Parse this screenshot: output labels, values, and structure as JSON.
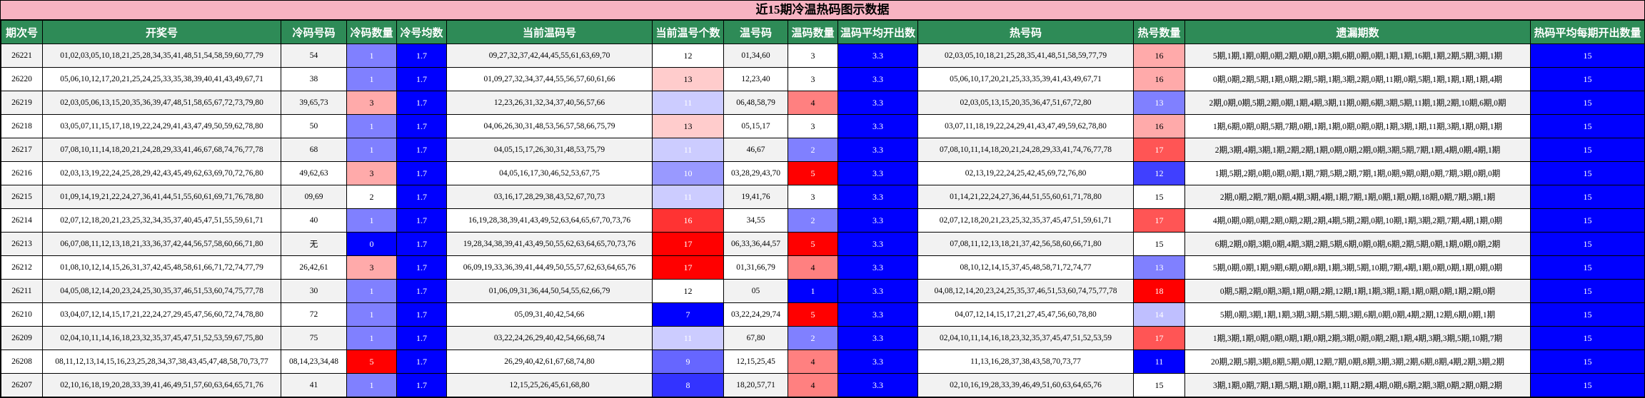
{
  "title": "近15期冷温热码图示数据",
  "headers": [
    "期次号",
    "开奖号",
    "冷码号码",
    "冷码数量",
    "冷号均数",
    "当前温码号",
    "当前温号个数",
    "温号码",
    "温码数量",
    "温码平均开出数",
    "热号码",
    "热号数量",
    "遗漏期数",
    "热码平均每期开出数量"
  ],
  "colors": {
    "header_bg": "#2e8b57",
    "title_bg": "#f7b3c2",
    "blue": "#0000ff",
    "red": "#ff0000",
    "row_alt": "#f2f2f2"
  },
  "rows": [
    {
      "period": "26221",
      "draw": "01,02,03,05,10,18,21,25,28,34,35,41,48,51,54,58,59,60,77,79",
      "cold": "54",
      "cold_cnt": "1",
      "cold_avg": "1.7",
      "warm": "09,27,32,37,42,44,45,55,61,63,69,70",
      "warm_cnt": "12",
      "warm_hit": "01,34,60",
      "warm_hit_cnt": "3",
      "warm_avg": "3.3",
      "hot": "02,03,05,10,18,21,25,28,35,41,48,51,58,59,77,79",
      "hot_cnt": "16",
      "miss": "5期,1期,1期,0期,0期,2期,0期,0期,3期,6期,0期,0期,1期,1期,16期,1期,2期,5期,3期,1期",
      "hot_avg": "15"
    },
    {
      "period": "26220",
      "draw": "05,06,10,12,17,20,21,25,24,25,33,35,38,39,40,41,43,49,67,71",
      "cold": "38",
      "cold_cnt": "1",
      "cold_avg": "1.7",
      "warm": "01,09,27,32,34,37,44,55,56,57,60,61,66",
      "warm_cnt": "13",
      "warm_hit": "12,23,40",
      "warm_hit_cnt": "3",
      "warm_avg": "3.3",
      "hot": "05,06,10,17,20,21,25,33,35,39,41,43,49,67,71",
      "hot_cnt": "16",
      "miss": "0期,0期,2期,5期,1期,0期,2期,5期,1期,3期,2期,0期,11期,0期,5期,1期,1期,1期,1期,4期",
      "hot_avg": "15"
    },
    {
      "period": "26219",
      "draw": "02,03,05,06,13,15,20,35,36,39,47,48,51,58,65,67,72,73,79,80",
      "cold": "39,65,73",
      "cold_cnt": "3",
      "cold_avg": "1.7",
      "warm": "12,23,26,31,32,34,37,40,56,57,66",
      "warm_cnt": "11",
      "warm_hit": "06,48,58,79",
      "warm_hit_cnt": "4",
      "warm_avg": "3.3",
      "hot": "02,03,05,13,15,20,35,36,47,51,67,72,80",
      "hot_cnt": "13",
      "miss": "2期,0期,0期,5期,2期,0期,1期,4期,3期,11期,0期,6期,3期,5期,11期,1期,2期,10期,6期,0期",
      "hot_avg": "15"
    },
    {
      "period": "26218",
      "draw": "03,05,07,11,15,17,18,19,22,24,29,41,43,47,49,50,59,62,78,80",
      "cold": "50",
      "cold_cnt": "1",
      "cold_avg": "1.7",
      "warm": "04,06,26,30,31,48,53,56,57,58,66,75,79",
      "warm_cnt": "13",
      "warm_hit": "05,15,17",
      "warm_hit_cnt": "3",
      "warm_avg": "3.3",
      "hot": "03,07,11,18,19,22,24,29,41,43,47,49,59,62,78,80",
      "hot_cnt": "16",
      "miss": "1期,6期,0期,0期,5期,7期,0期,1期,1期,0期,0期,0期,1期,3期,1期,11期,3期,1期,0期,1期",
      "hot_avg": "15"
    },
    {
      "period": "26217",
      "draw": "07,08,10,11,14,18,20,21,24,28,29,33,41,46,67,68,74,76,77,78",
      "cold": "68",
      "cold_cnt": "1",
      "cold_avg": "1.7",
      "warm": "04,05,15,17,26,30,31,48,53,75,79",
      "warm_cnt": "11",
      "warm_hit": "46,67",
      "warm_hit_cnt": "2",
      "warm_avg": "3.3",
      "hot": "07,08,10,11,14,18,20,21,24,28,29,33,41,74,76,77,78",
      "hot_cnt": "17",
      "miss": "2期,3期,4期,3期,1期,2期,2期,1期,0期,0期,2期,0期,3期,5期,7期,1期,4期,0期,4期,1期",
      "hot_avg": "15"
    },
    {
      "period": "26216",
      "draw": "02,03,13,19,22,24,25,28,29,42,43,45,49,62,63,69,70,72,76,80",
      "cold": "49,62,63",
      "cold_cnt": "3",
      "cold_avg": "1.7",
      "warm": "04,05,16,17,30,46,52,53,67,75",
      "warm_cnt": "10",
      "warm_hit": "03,28,29,43,70",
      "warm_hit_cnt": "5",
      "warm_avg": "3.3",
      "hot": "02,13,19,22,24,25,42,45,69,72,76,80",
      "hot_cnt": "12",
      "miss": "1期,5期,2期,0期,0期,0期,1期,7期,5期,2期,7期,1期,0期,9期,0期,0期,7期,3期,0期,0期",
      "hot_avg": "15"
    },
    {
      "period": "26215",
      "draw": "01,09,14,19,21,22,24,27,36,41,44,51,55,60,61,69,71,76,78,80",
      "cold": "09,69",
      "cold_cnt": "2",
      "cold_avg": "1.7",
      "warm": "03,16,17,28,29,38,43,52,67,70,73",
      "warm_cnt": "11",
      "warm_hit": "19,41,76",
      "warm_hit_cnt": "3",
      "warm_avg": "3.3",
      "hot": "01,14,21,22,24,27,36,44,51,55,60,61,71,78,80",
      "hot_cnt": "15",
      "miss": "2期,0期,2期,7期,0期,4期,3期,4期,1期,7期,1期,0期,1期,0期,18期,0期,7期,3期,1期",
      "hot_avg": "15"
    },
    {
      "period": "26214",
      "draw": "02,07,12,18,20,21,23,25,32,34,35,37,40,45,47,51,55,59,61,71",
      "cold": "40",
      "cold_cnt": "1",
      "cold_avg": "1.7",
      "warm": "16,19,28,38,39,41,43,49,52,63,64,65,67,70,73,76",
      "warm_cnt": "16",
      "warm_hit": "34,55",
      "warm_hit_cnt": "2",
      "warm_avg": "3.3",
      "hot": "02,07,12,18,20,21,23,25,32,35,37,45,47,51,59,61,71",
      "hot_cnt": "17",
      "miss": "4期,0期,0期,0期,2期,0期,2期,2期,4期,5期,2期,0期,10期,1期,3期,2期,7期,4期,1期,0期",
      "hot_avg": "15"
    },
    {
      "period": "26213",
      "draw": "06,07,08,11,12,13,18,21,33,36,37,42,44,56,57,58,60,66,71,80",
      "cold": "无",
      "cold_cnt": "0",
      "cold_avg": "1.7",
      "warm": "19,28,34,38,39,41,43,49,50,55,62,63,64,65,70,73,76",
      "warm_cnt": "17",
      "warm_hit": "06,33,36,44,57",
      "warm_hit_cnt": "5",
      "warm_avg": "3.3",
      "hot": "07,08,11,12,13,18,21,37,42,56,58,60,66,71,80",
      "hot_cnt": "15",
      "miss": "6期,2期,0期,3期,0期,4期,3期,2期,5期,6期,0期,0期,6期,2期,5期,0期,1期,0期,0期,2期",
      "hot_avg": "15"
    },
    {
      "period": "26212",
      "draw": "01,08,10,12,14,15,26,31,37,42,45,48,58,61,66,71,72,74,77,79",
      "cold": "26,42,61",
      "cold_cnt": "3",
      "cold_avg": "1.7",
      "warm": "06,09,19,33,36,39,41,44,49,50,55,57,62,63,64,65,76",
      "warm_cnt": "17",
      "warm_hit": "01,31,66,79",
      "warm_hit_cnt": "4",
      "warm_avg": "3.3",
      "hot": "08,10,12,14,15,37,45,48,58,71,72,74,77",
      "hot_cnt": "13",
      "miss": "5期,0期,0期,1期,9期,6期,0期,8期,1期,3期,5期,10期,7期,4期,1期,0期,0期,1期,0期,0期",
      "hot_avg": "15"
    },
    {
      "period": "26211",
      "draw": "04,05,08,12,14,20,23,24,25,30,35,37,46,51,53,60,74,75,77,78",
      "cold": "30",
      "cold_cnt": "1",
      "cold_avg": "1.7",
      "warm": "01,06,09,31,36,44,50,54,55,62,66,79",
      "warm_cnt": "12",
      "warm_hit": "05",
      "warm_hit_cnt": "1",
      "warm_avg": "3.3",
      "hot": "04,08,12,14,20,23,24,25,35,37,46,51,53,60,74,75,77,78",
      "hot_cnt": "18",
      "miss": "0期,5期,2期,0期,3期,1期,0期,2期,12期,1期,1期,3期,1期,1期,0期,0期,1期,2期,0期",
      "hot_avg": "15"
    },
    {
      "period": "26210",
      "draw": "03,04,07,12,14,15,17,21,22,24,27,29,45,47,56,60,72,74,78,80",
      "cold": "72",
      "cold_cnt": "1",
      "cold_avg": "1.7",
      "warm": "05,09,31,40,42,54,66",
      "warm_cnt": "7",
      "warm_hit": "03,22,24,29,74",
      "warm_hit_cnt": "5",
      "warm_avg": "3.3",
      "hot": "04,07,12,14,15,17,21,27,45,47,56,60,78,80",
      "hot_cnt": "14",
      "miss": "5期,0期,3期,1期,1期,3期,3期,5期,5期,3期,6期,0期,0期,4期,2期,12期,6期,0期,1期",
      "hot_avg": "15"
    },
    {
      "period": "26209",
      "draw": "02,04,10,11,14,16,18,23,32,35,37,45,47,51,52,53,59,67,75,80",
      "cold": "75",
      "cold_cnt": "1",
      "cold_avg": "1.7",
      "warm": "03,22,24,26,29,40,42,54,66,68,74",
      "warm_cnt": "11",
      "warm_hit": "67,80",
      "warm_hit_cnt": "2",
      "warm_avg": "3.3",
      "hot": "02,04,10,11,14,16,18,23,32,35,37,45,47,51,52,53,59",
      "hot_cnt": "17",
      "miss": "1期,3期,1期,0期,0期,0期,1期,0期,2期,3期,0期,0期,2期,1期,4期,3期,3期,5期,10期,7期",
      "hot_avg": "15"
    },
    {
      "period": "26208",
      "draw": "08,11,12,13,14,15,16,23,25,28,34,37,38,43,45,47,48,58,70,73,77",
      "cold": "08,14,23,34,48",
      "cold_cnt": "5",
      "cold_avg": "1.7",
      "warm": "26,29,40,42,61,67,68,74,80",
      "warm_cnt": "9",
      "warm_hit": "12,15,25,45",
      "warm_hit_cnt": "4",
      "warm_avg": "3.3",
      "hot": "11,13,16,28,37,38,43,58,70,73,77",
      "hot_cnt": "11",
      "miss": "20期,2期,5期,3期,8期,5期,0期,12期,7期,0期,8期,3期,3期,2期,6期,8期,4期,2期,3期,2期",
      "hot_avg": "15"
    },
    {
      "period": "26207",
      "draw": "02,10,16,18,19,20,28,33,39,41,46,49,51,57,60,63,64,65,71,76",
      "cold": "41",
      "cold_cnt": "1",
      "cold_avg": "1.7",
      "warm": "12,15,25,26,45,61,68,80",
      "warm_cnt": "8",
      "warm_hit": "18,20,57,71",
      "warm_hit_cnt": "4",
      "warm_avg": "3.3",
      "hot": "02,10,16,19,28,33,39,46,49,51,60,63,64,65,76",
      "hot_cnt": "15",
      "miss": "3期,1期,0期,7期,1期,5期,1期,0期,1期,11期,2期,4期,0期,6期,2期,3期,0期,2期,0期,2期",
      "hot_avg": "15"
    }
  ]
}
